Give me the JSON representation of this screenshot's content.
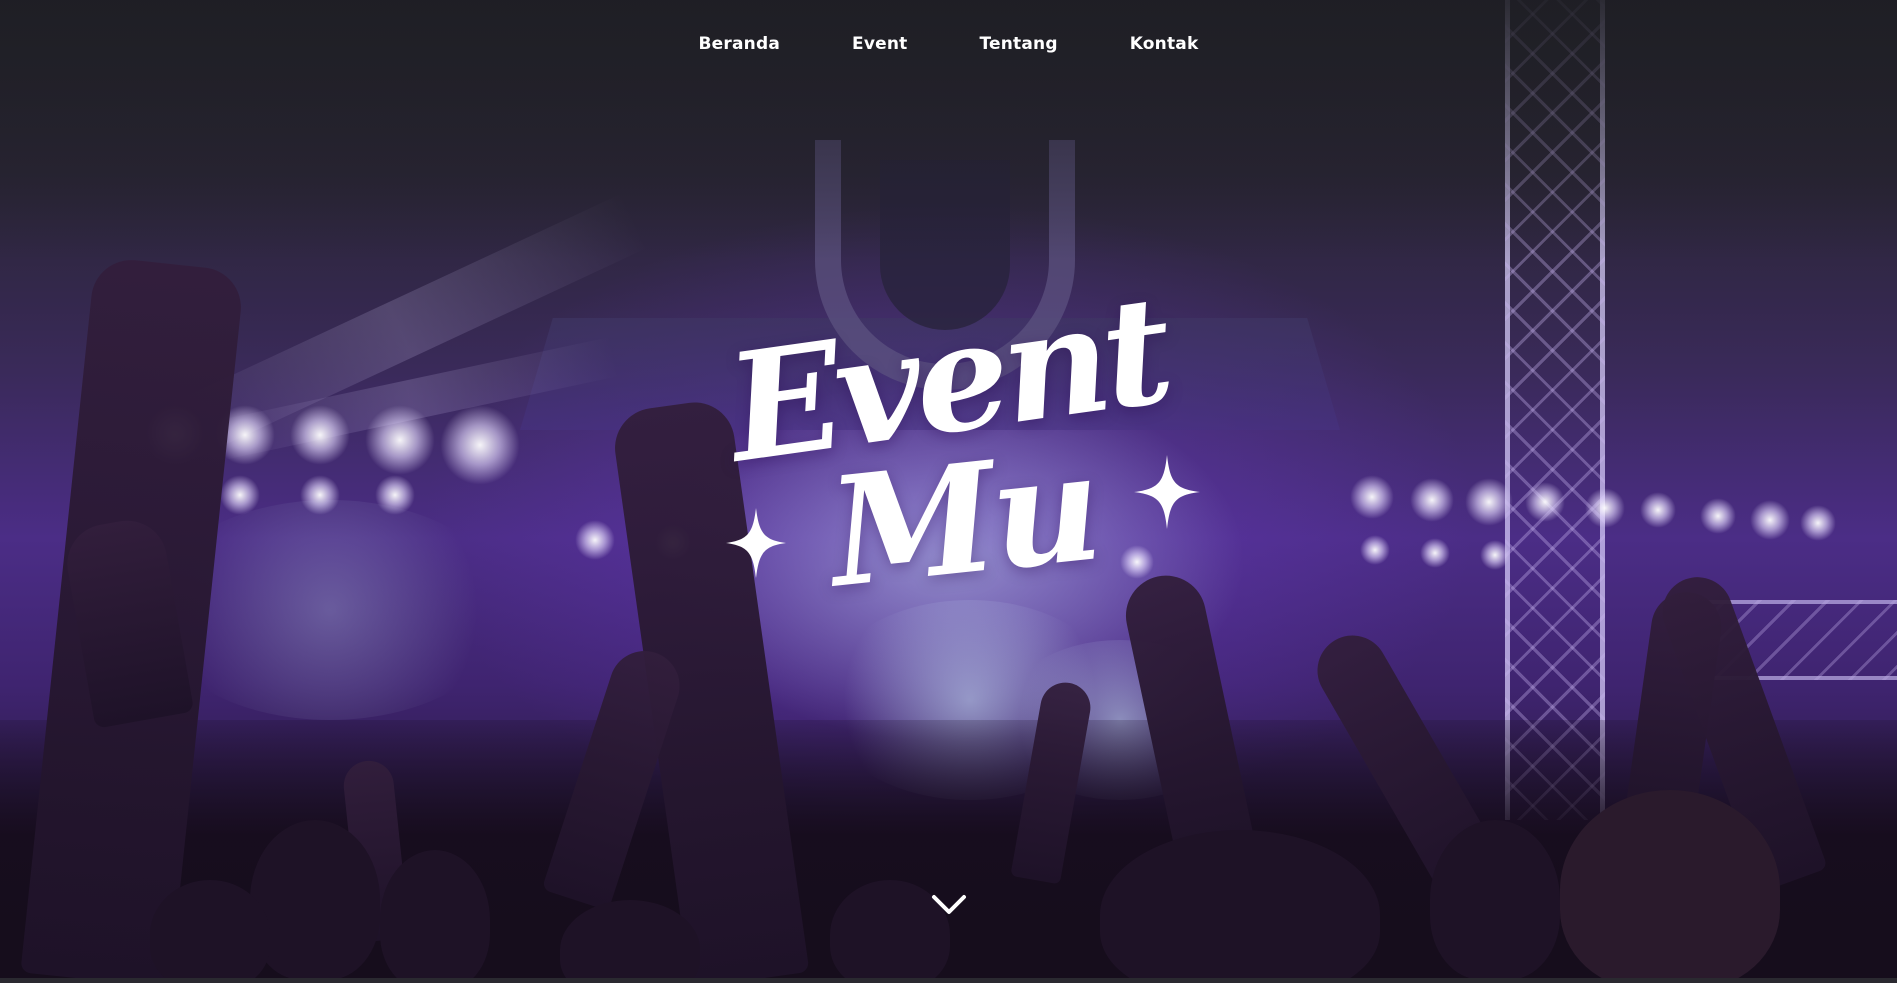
{
  "nav": {
    "items": [
      {
        "label": "Beranda"
      },
      {
        "label": "Event"
      },
      {
        "label": "Tentang"
      },
      {
        "label": "Kontak"
      }
    ]
  },
  "hero": {
    "logo_line1": "Event",
    "logo_line2": "Mu",
    "scroll_icon": "chevron-down-icon"
  },
  "colors": {
    "text": "#ffffff",
    "accent_purple": "#4b2d86"
  }
}
